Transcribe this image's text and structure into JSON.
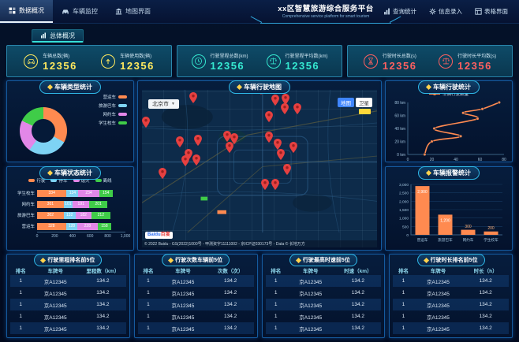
{
  "colors": {
    "accent": "#2fb9e8",
    "panel_border": "#155a9e",
    "yellow": "#ffe95e",
    "cyan": "#35e8d0",
    "red": "#ff6060",
    "orange": "#ff8a50",
    "light_blue": "#7ed3f4",
    "magenta": "#e287e8",
    "green": "#3fcc48"
  },
  "header": {
    "title": "xx区智慧旅游综合服务平台",
    "subtitle": "Comprehensive service platform for smart tourism",
    "tabs": [
      {
        "label": "数据概况",
        "icon": "dashboard-icon",
        "active": true
      },
      {
        "label": "车辆监控",
        "icon": "vehicle-icon",
        "active": false
      },
      {
        "label": "地图界面",
        "icon": "map-icon",
        "active": false
      }
    ],
    "menu": [
      {
        "label": "查询统计",
        "icon": "stats-icon"
      },
      {
        "label": "信息录入",
        "icon": "gear-icon"
      },
      {
        "label": "表格界面",
        "icon": "table-icon"
      }
    ]
  },
  "overview_button": {
    "label": "总体概况",
    "icon": "bar-icon"
  },
  "kpi_groups": [
    {
      "items": [
        {
          "icon": "car-icon",
          "label": "车辆总数(辆)",
          "value": "12356",
          "color": "#ffe95e"
        },
        {
          "icon": "arrow-up-icon",
          "label": "车辆使用数(辆)",
          "value": "12356",
          "color": "#ffe95e"
        }
      ]
    },
    {
      "items": [
        {
          "icon": "clock-icon",
          "label": "行驶里程总数(km)",
          "value": "12356",
          "color": "#35e8d0"
        },
        {
          "icon": "scale-icon",
          "label": "行驶里程平均数(km)",
          "value": "12356",
          "color": "#35e8d0"
        }
      ]
    },
    {
      "items": [
        {
          "icon": "hourglass-icon",
          "label": "行驶时长总数(s)",
          "value": "12356",
          "color": "#ff6060"
        },
        {
          "icon": "scale-icon",
          "label": "行驶时长平均数(s)",
          "value": "12356",
          "color": "#ff6060"
        }
      ]
    }
  ],
  "chart_data": [
    {
      "type": "pie",
      "donut": true,
      "title": "车辆类型统计",
      "legend_position": "right",
      "labels": [
        "营运车",
        "旅游巴车",
        "网约车",
        "学生校车"
      ],
      "values": [
        33,
        27,
        22,
        18
      ],
      "colors": [
        "#ff8a50",
        "#7ed3f4",
        "#e287e8",
        "#3fcc48"
      ]
    },
    {
      "type": "bar",
      "orientation": "horizontal",
      "stacked": true,
      "title": "车辆状态统计",
      "categories": [
        "学生校车",
        "网约车",
        "旅游巴车",
        "营运车"
      ],
      "series": [
        {
          "name": "行驶",
          "color": "#ff8a50",
          "values": [
            334,
            301,
            302,
            328
          ]
        },
        {
          "name": "停车",
          "color": "#7ed3f4",
          "values": [
            134,
            101,
            132,
            128
          ]
        },
        {
          "name": "熄火",
          "color": "#e287e8",
          "values": [
            234,
            191,
            182,
            228
          ]
        },
        {
          "name": "离线",
          "color": "#3fcc48",
          "values": [
            154,
            201,
            212,
            158
          ]
        }
      ],
      "xlim": [
        0,
        1000
      ],
      "xticks": [
        "0",
        "200",
        "400",
        "600",
        "800",
        "1,000"
      ]
    },
    {
      "type": "line",
      "title": "车辆行驶统计",
      "legend": [
        "车辆行驶数量"
      ],
      "color": "#ff8a50",
      "points": [
        [
          14,
          0
        ],
        [
          20,
          20
        ],
        [
          44,
          28
        ],
        [
          22,
          40
        ],
        [
          58,
          55
        ],
        [
          46,
          64
        ],
        [
          62,
          70
        ],
        [
          76,
          80
        ]
      ],
      "xlim": [
        0,
        80
      ],
      "ylim": [
        0,
        80
      ],
      "xticks": [
        "0",
        "20",
        "40",
        "60",
        "80"
      ],
      "yticks": [
        "0 km",
        "20 km",
        "40 km",
        "60 km",
        "80 km"
      ]
    },
    {
      "type": "bar",
      "title": "车辆报警统计",
      "color": "#ff8a50",
      "categories": [
        "营运车",
        "旅游巴车",
        "网约车",
        "学生校车"
      ],
      "values": [
        2900,
        1200,
        300,
        200
      ],
      "value_labels": [
        "2,900",
        "1,200",
        "300",
        "200"
      ],
      "ylim": [
        0,
        3000
      ],
      "yticks": [
        "0",
        "500",
        "1,000",
        "1,500",
        "2,000",
        "2,500",
        "3,000"
      ]
    }
  ],
  "map": {
    "title": "车辆行驶地图",
    "city_selector": "北京市",
    "controls": [
      {
        "label": "地图",
        "active": true
      },
      {
        "label": "卫星",
        "active": false
      }
    ],
    "logo": {
      "part1": "Baidu",
      "part2": "百度"
    },
    "attribution": "© 2022 Baidu - GS(2022)1000号 - 甲测资字11111002 - 京ICP证030173号 - Data © 长地万方",
    "pins": [
      [
        21.8,
        8.6
      ],
      [
        50.7,
        3.2
      ],
      [
        56.8,
        9.9
      ],
      [
        61.1,
        9.4
      ],
      [
        60.9,
        15.7
      ],
      [
        66.0,
        15.5
      ],
      [
        54.1,
        20.5
      ],
      [
        1.6,
        24.0
      ],
      [
        36.1,
        32.8
      ],
      [
        39.3,
        34.6
      ],
      [
        37.2,
        39.8
      ],
      [
        23.9,
        35.4
      ],
      [
        16.1,
        36.7
      ],
      [
        19.8,
        44.6
      ],
      [
        18.6,
        48.7
      ],
      [
        23.1,
        47.8
      ],
      [
        8.6,
        56.6
      ],
      [
        54.1,
        33.3
      ],
      [
        57.7,
        38.1
      ],
      [
        58.9,
        44.3
      ],
      [
        64.5,
        39.8
      ],
      [
        61.6,
        54.0
      ],
      [
        52.5,
        63.7
      ],
      [
        56.8,
        63.3
      ]
    ]
  },
  "tables": [
    {
      "title": "行驶里程排名前5位",
      "columns": [
        "排名",
        "车牌号",
        "里程数（km）"
      ],
      "rows": [
        [
          "1",
          "京A12345",
          "134.2"
        ],
        [
          "1",
          "京A12345",
          "134.2"
        ],
        [
          "1",
          "京A12345",
          "134.2"
        ],
        [
          "1",
          "京A12345",
          "134.2"
        ],
        [
          "1",
          "京A12345",
          "134.2"
        ]
      ]
    },
    {
      "title": "行驶次数车辆前5位",
      "columns": [
        "排名",
        "车牌号",
        "次数（次）"
      ],
      "rows": [
        [
          "1",
          "京A12345",
          "134.2"
        ],
        [
          "1",
          "京A12345",
          "134.2"
        ],
        [
          "1",
          "京A12345",
          "134.2"
        ],
        [
          "1",
          "京A12345",
          "134.2"
        ],
        [
          "1",
          "京A12345",
          "134.2"
        ]
      ]
    },
    {
      "title": "行驶最高时速前5位",
      "columns": [
        "排名",
        "车牌号",
        "时速（km）"
      ],
      "rows": [
        [
          "1",
          "京A12345",
          "134.2"
        ],
        [
          "1",
          "京A12345",
          "134.2"
        ],
        [
          "1",
          "京A12345",
          "134.2"
        ],
        [
          "1",
          "京A12345",
          "134.2"
        ],
        [
          "1",
          "京A12345",
          "134.2"
        ]
      ]
    },
    {
      "title": "行驶时长排名前5位",
      "columns": [
        "排名",
        "车牌号",
        "时长（h）"
      ],
      "rows": [
        [
          "1",
          "京A12345",
          "134.2"
        ],
        [
          "1",
          "京A12345",
          "134.2"
        ],
        [
          "1",
          "京A12345",
          "134.2"
        ],
        [
          "1",
          "京A12345",
          "134.2"
        ],
        [
          "1",
          "京A12345",
          "134.2"
        ]
      ]
    }
  ]
}
